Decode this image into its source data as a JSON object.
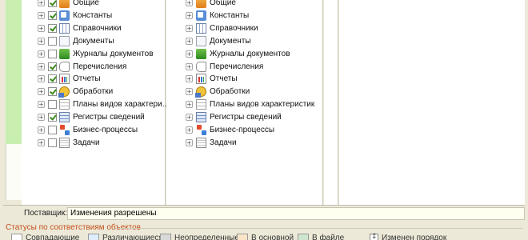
{
  "left_tree": [
    {
      "label": "Общие",
      "checked": true,
      "icon": "common-icon"
    },
    {
      "label": "Константы",
      "checked": true,
      "icon": "constants-icon"
    },
    {
      "label": "Справочники",
      "checked": true,
      "icon": "catalogs-icon"
    },
    {
      "label": "Документы",
      "checked": false,
      "icon": "documents-icon"
    },
    {
      "label": "Журналы документов",
      "checked": false,
      "icon": "document-journals-icon"
    },
    {
      "label": "Перечисления",
      "checked": true,
      "icon": "enumerations-icon"
    },
    {
      "label": "Отчеты",
      "checked": true,
      "icon": "reports-icon"
    },
    {
      "label": "Обработки",
      "checked": true,
      "icon": "data-processors-icon"
    },
    {
      "label": "Планы видов характери...",
      "checked": false,
      "icon": "characteristic-types-icon"
    },
    {
      "label": "Регистры сведений",
      "checked": true,
      "icon": "information-registers-icon"
    },
    {
      "label": "Бизнес-процессы",
      "checked": false,
      "icon": "business-processes-icon"
    },
    {
      "label": "Задачи",
      "checked": false,
      "icon": "tasks-icon"
    }
  ],
  "right_tree": [
    {
      "label": "Общие",
      "icon": "common-icon"
    },
    {
      "label": "Константы",
      "icon": "constants-icon"
    },
    {
      "label": "Справочники",
      "icon": "catalogs-icon"
    },
    {
      "label": "Документы",
      "icon": "documents-icon"
    },
    {
      "label": "Журналы документов",
      "icon": "document-journals-icon"
    },
    {
      "label": "Перечисления",
      "icon": "enumerations-icon"
    },
    {
      "label": "Отчеты",
      "icon": "reports-icon"
    },
    {
      "label": "Обработки",
      "icon": "data-processors-icon"
    },
    {
      "label": "Планы видов характеристик",
      "icon": "characteristic-types-icon"
    },
    {
      "label": "Регистры сведений",
      "icon": "information-registers-icon"
    },
    {
      "label": "Бизнес-процессы",
      "icon": "business-processes-icon"
    },
    {
      "label": "Задачи",
      "icon": "tasks-icon"
    }
  ],
  "supplier": {
    "label": "Поставщик:",
    "value": "Изменения разрешены"
  },
  "statuses": {
    "title": "Статусы по соответствиям объектов",
    "items": [
      {
        "label": "Совпадающие",
        "color": "#ffffff"
      },
      {
        "label": "Различающиеся",
        "color": "#dfeefc"
      },
      {
        "label": "Неопределенные",
        "color": "#d9d9d9"
      },
      {
        "label": "В основной",
        "color": "#fbe3c8"
      },
      {
        "label": "В файле",
        "color": "#cfe5cf"
      }
    ],
    "order_label": "Изменен порядок"
  }
}
